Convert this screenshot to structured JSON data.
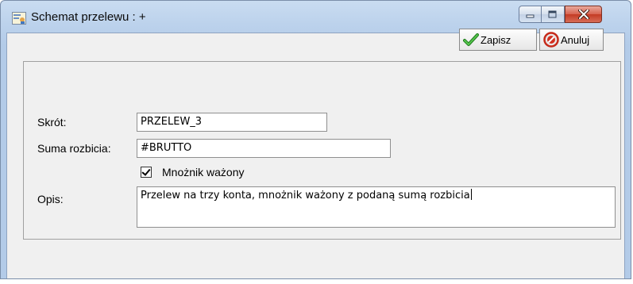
{
  "window": {
    "title": "Schemat przelewu : +",
    "buttons": {
      "minimize": "minimize",
      "maximize": "maximize",
      "close": "close"
    }
  },
  "toolbar": {
    "save_label": "Zapisz",
    "cancel_label": "Anuluj"
  },
  "form": {
    "skrot_label": "Skrót:",
    "skrot_value": "PRZELEW_3",
    "suma_label": "Suma rozbicia:",
    "suma_value": "#BRUTTO",
    "mnoznik_label": "Mnożnik ważony",
    "mnoznik_checked": true,
    "opis_label": "Opis:",
    "opis_value": "Przelew na trzy konta, mnożnik ważony z podaną sumą rozbicia"
  },
  "colors": {
    "titlebar": "#bcd2ec",
    "client_bg": "#f0f0f0",
    "close_red": "#c43b24",
    "save_check_green": "#2e9e2a",
    "cancel_red": "#d33020"
  },
  "icons": {
    "app": "form-app-icon",
    "save": "green-check-icon",
    "cancel": "red-cancel-icon"
  }
}
